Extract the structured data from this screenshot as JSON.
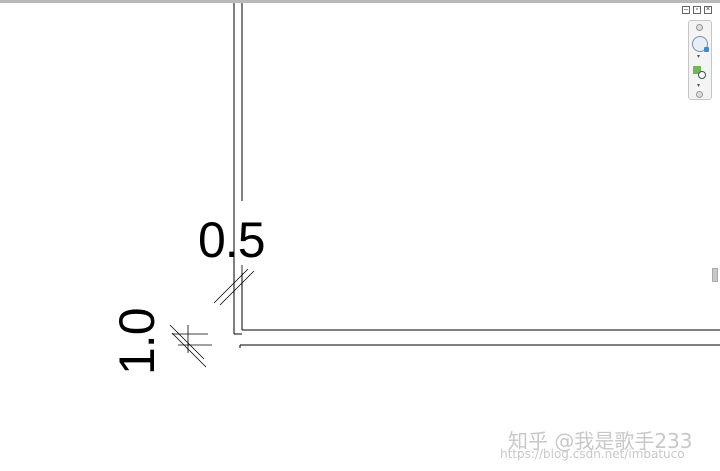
{
  "dimensions": {
    "horizontal_label": "0.5",
    "vertical_label": "1.0"
  },
  "window_controls": {
    "minimize_icon": "minimize-icon",
    "restore_icon": "restore-icon",
    "close_icon": "close-icon"
  },
  "navigation_bar": {
    "wheel_icon": "steering-wheel-icon",
    "zoom_icon": "zoom-region-icon"
  },
  "watermark": {
    "text": "知乎 @我是歌手233",
    "url": "https://blog.csdn.net/imbatuco"
  }
}
